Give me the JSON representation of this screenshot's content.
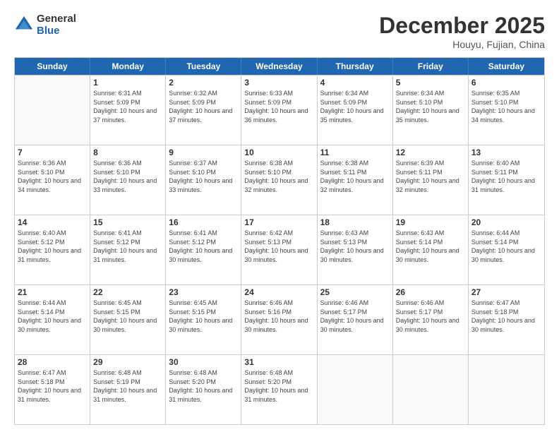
{
  "logo": {
    "line1": "General",
    "line2": "Blue"
  },
  "header": {
    "title": "December 2025",
    "subtitle": "Houyu, Fujian, China"
  },
  "weekdays": [
    "Sunday",
    "Monday",
    "Tuesday",
    "Wednesday",
    "Thursday",
    "Friday",
    "Saturday"
  ],
  "weeks": [
    [
      {
        "day": "",
        "sunrise": "",
        "sunset": "",
        "daylight": ""
      },
      {
        "day": "1",
        "sunrise": "Sunrise: 6:31 AM",
        "sunset": "Sunset: 5:09 PM",
        "daylight": "Daylight: 10 hours and 37 minutes."
      },
      {
        "day": "2",
        "sunrise": "Sunrise: 6:32 AM",
        "sunset": "Sunset: 5:09 PM",
        "daylight": "Daylight: 10 hours and 37 minutes."
      },
      {
        "day": "3",
        "sunrise": "Sunrise: 6:33 AM",
        "sunset": "Sunset: 5:09 PM",
        "daylight": "Daylight: 10 hours and 36 minutes."
      },
      {
        "day": "4",
        "sunrise": "Sunrise: 6:34 AM",
        "sunset": "Sunset: 5:09 PM",
        "daylight": "Daylight: 10 hours and 35 minutes."
      },
      {
        "day": "5",
        "sunrise": "Sunrise: 6:34 AM",
        "sunset": "Sunset: 5:10 PM",
        "daylight": "Daylight: 10 hours and 35 minutes."
      },
      {
        "day": "6",
        "sunrise": "Sunrise: 6:35 AM",
        "sunset": "Sunset: 5:10 PM",
        "daylight": "Daylight: 10 hours and 34 minutes."
      }
    ],
    [
      {
        "day": "7",
        "sunrise": "Sunrise: 6:36 AM",
        "sunset": "Sunset: 5:10 PM",
        "daylight": "Daylight: 10 hours and 34 minutes."
      },
      {
        "day": "8",
        "sunrise": "Sunrise: 6:36 AM",
        "sunset": "Sunset: 5:10 PM",
        "daylight": "Daylight: 10 hours and 33 minutes."
      },
      {
        "day": "9",
        "sunrise": "Sunrise: 6:37 AM",
        "sunset": "Sunset: 5:10 PM",
        "daylight": "Daylight: 10 hours and 33 minutes."
      },
      {
        "day": "10",
        "sunrise": "Sunrise: 6:38 AM",
        "sunset": "Sunset: 5:10 PM",
        "daylight": "Daylight: 10 hours and 32 minutes."
      },
      {
        "day": "11",
        "sunrise": "Sunrise: 6:38 AM",
        "sunset": "Sunset: 5:11 PM",
        "daylight": "Daylight: 10 hours and 32 minutes."
      },
      {
        "day": "12",
        "sunrise": "Sunrise: 6:39 AM",
        "sunset": "Sunset: 5:11 PM",
        "daylight": "Daylight: 10 hours and 32 minutes."
      },
      {
        "day": "13",
        "sunrise": "Sunrise: 6:40 AM",
        "sunset": "Sunset: 5:11 PM",
        "daylight": "Daylight: 10 hours and 31 minutes."
      }
    ],
    [
      {
        "day": "14",
        "sunrise": "Sunrise: 6:40 AM",
        "sunset": "Sunset: 5:12 PM",
        "daylight": "Daylight: 10 hours and 31 minutes."
      },
      {
        "day": "15",
        "sunrise": "Sunrise: 6:41 AM",
        "sunset": "Sunset: 5:12 PM",
        "daylight": "Daylight: 10 hours and 31 minutes."
      },
      {
        "day": "16",
        "sunrise": "Sunrise: 6:41 AM",
        "sunset": "Sunset: 5:12 PM",
        "daylight": "Daylight: 10 hours and 30 minutes."
      },
      {
        "day": "17",
        "sunrise": "Sunrise: 6:42 AM",
        "sunset": "Sunset: 5:13 PM",
        "daylight": "Daylight: 10 hours and 30 minutes."
      },
      {
        "day": "18",
        "sunrise": "Sunrise: 6:43 AM",
        "sunset": "Sunset: 5:13 PM",
        "daylight": "Daylight: 10 hours and 30 minutes."
      },
      {
        "day": "19",
        "sunrise": "Sunrise: 6:43 AM",
        "sunset": "Sunset: 5:14 PM",
        "daylight": "Daylight: 10 hours and 30 minutes."
      },
      {
        "day": "20",
        "sunrise": "Sunrise: 6:44 AM",
        "sunset": "Sunset: 5:14 PM",
        "daylight": "Daylight: 10 hours and 30 minutes."
      }
    ],
    [
      {
        "day": "21",
        "sunrise": "Sunrise: 6:44 AM",
        "sunset": "Sunset: 5:14 PM",
        "daylight": "Daylight: 10 hours and 30 minutes."
      },
      {
        "day": "22",
        "sunrise": "Sunrise: 6:45 AM",
        "sunset": "Sunset: 5:15 PM",
        "daylight": "Daylight: 10 hours and 30 minutes."
      },
      {
        "day": "23",
        "sunrise": "Sunrise: 6:45 AM",
        "sunset": "Sunset: 5:15 PM",
        "daylight": "Daylight: 10 hours and 30 minutes."
      },
      {
        "day": "24",
        "sunrise": "Sunrise: 6:46 AM",
        "sunset": "Sunset: 5:16 PM",
        "daylight": "Daylight: 10 hours and 30 minutes."
      },
      {
        "day": "25",
        "sunrise": "Sunrise: 6:46 AM",
        "sunset": "Sunset: 5:17 PM",
        "daylight": "Daylight: 10 hours and 30 minutes."
      },
      {
        "day": "26",
        "sunrise": "Sunrise: 6:46 AM",
        "sunset": "Sunset: 5:17 PM",
        "daylight": "Daylight: 10 hours and 30 minutes."
      },
      {
        "day": "27",
        "sunrise": "Sunrise: 6:47 AM",
        "sunset": "Sunset: 5:18 PM",
        "daylight": "Daylight: 10 hours and 30 minutes."
      }
    ],
    [
      {
        "day": "28",
        "sunrise": "Sunrise: 6:47 AM",
        "sunset": "Sunset: 5:18 PM",
        "daylight": "Daylight: 10 hours and 31 minutes."
      },
      {
        "day": "29",
        "sunrise": "Sunrise: 6:48 AM",
        "sunset": "Sunset: 5:19 PM",
        "daylight": "Daylight: 10 hours and 31 minutes."
      },
      {
        "day": "30",
        "sunrise": "Sunrise: 6:48 AM",
        "sunset": "Sunset: 5:20 PM",
        "daylight": "Daylight: 10 hours and 31 minutes."
      },
      {
        "day": "31",
        "sunrise": "Sunrise: 6:48 AM",
        "sunset": "Sunset: 5:20 PM",
        "daylight": "Daylight: 10 hours and 31 minutes."
      },
      {
        "day": "",
        "sunrise": "",
        "sunset": "",
        "daylight": ""
      },
      {
        "day": "",
        "sunrise": "",
        "sunset": "",
        "daylight": ""
      },
      {
        "day": "",
        "sunrise": "",
        "sunset": "",
        "daylight": ""
      }
    ]
  ]
}
